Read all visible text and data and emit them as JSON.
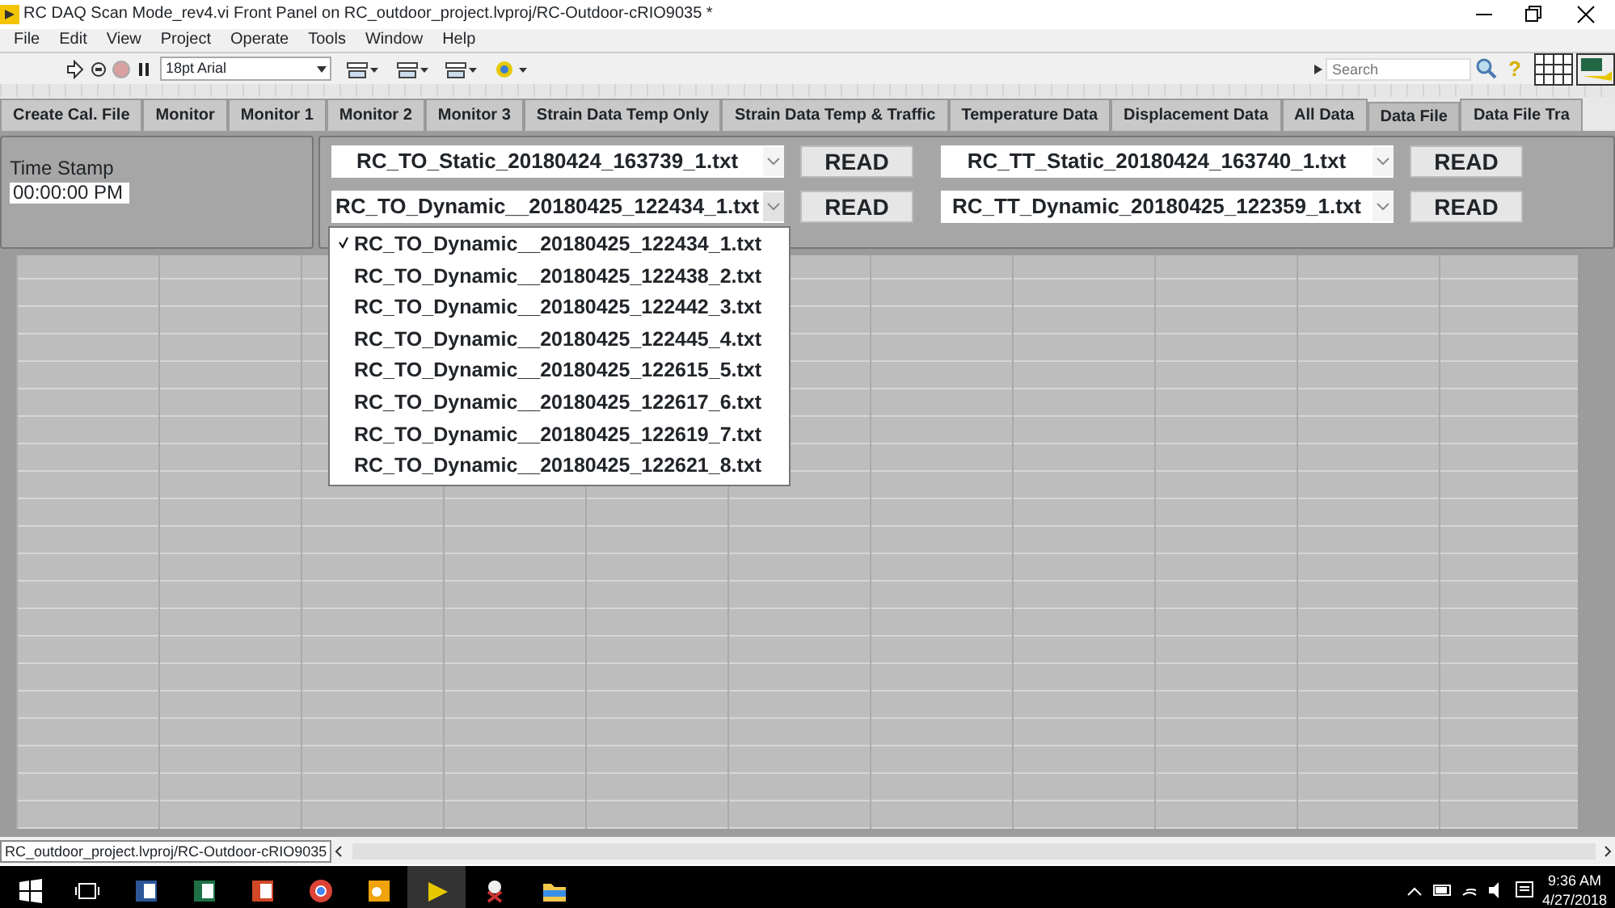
{
  "window": {
    "title": "RC DAQ Scan Mode_rev4.vi Front Panel on RC_outdoor_project.lvproj/RC-Outdoor-cRIO9035 *"
  },
  "menu": [
    "File",
    "Edit",
    "View",
    "Project",
    "Operate",
    "Tools",
    "Window",
    "Help"
  ],
  "toolbar": {
    "font": "18pt Arial",
    "search": {
      "placeholder": "Search"
    },
    "help": "?"
  },
  "tabs": [
    {
      "label": "Create Cal. File",
      "selected": false
    },
    {
      "label": "Monitor",
      "selected": false
    },
    {
      "label": "Monitor 1",
      "selected": false
    },
    {
      "label": "Monitor 2",
      "selected": false
    },
    {
      "label": "Monitor 3",
      "selected": false
    },
    {
      "label": "Strain Data Temp Only",
      "selected": false
    },
    {
      "label": "Strain Data Temp & Traffic",
      "selected": false
    },
    {
      "label": "Temperature Data",
      "selected": false
    },
    {
      "label": "Displacement Data",
      "selected": false
    },
    {
      "label": "All Data",
      "selected": false
    },
    {
      "label": "Data File",
      "selected": true
    },
    {
      "label": "Data File Tra",
      "selected": false
    }
  ],
  "time_stamp": {
    "label": "Time Stamp",
    "value": "00:00:00 PM"
  },
  "file_selectors": [
    {
      "value": "RC_TO_Static_20180424_163739_1.txt",
      "button": "READ"
    },
    {
      "value": "RC_TT_Static_20180424_163740_1.txt",
      "button": "READ"
    },
    {
      "value": "RC_TO_Dynamic__20180425_122434_1.txt",
      "button": "READ",
      "open": true
    },
    {
      "value": "RC_TT_Dynamic_20180425_122359_1.txt",
      "button": "READ"
    }
  ],
  "dropdown": [
    {
      "label": "RC_TO_Dynamic__20180425_122434_1.txt",
      "selected": true
    },
    {
      "label": "RC_TO_Dynamic__20180425_122438_2.txt",
      "selected": false
    },
    {
      "label": "RC_TO_Dynamic__20180425_122442_3.txt",
      "selected": false
    },
    {
      "label": "RC_TO_Dynamic__20180425_122445_4.txt",
      "selected": false
    },
    {
      "label": "RC_TO_Dynamic__20180425_122615_5.txt",
      "selected": false
    },
    {
      "label": "RC_TO_Dynamic__20180425_122617_6.txt",
      "selected": false
    },
    {
      "label": "RC_TO_Dynamic__20180425_122619_7.txt",
      "selected": false
    },
    {
      "label": "RC_TO_Dynamic__20180425_122621_8.txt",
      "selected": false
    }
  ],
  "status_bar": "RC_outdoor_project.lvproj/RC-Outdoor-cRIO9035",
  "taskbar": {
    "time": "9:36 AM",
    "date": "4/27/2018"
  }
}
